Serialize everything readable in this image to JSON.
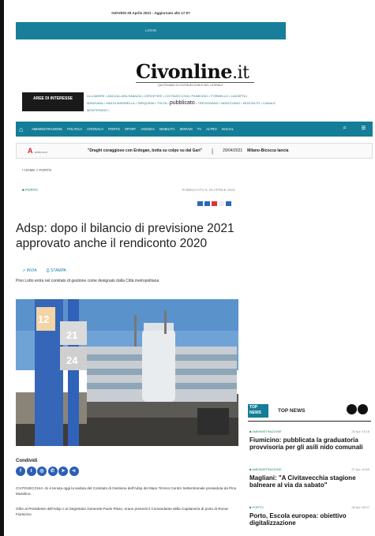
{
  "header": {
    "dateline": "GIOVEDI 29 Aprile 2021 - Aggiornato alle 17:07",
    "top_button": "LOGIN",
    "logo_main": "Civonline",
    "logo_tld": ".it",
    "logo_sub": "QUOTIDIANO DI CIVITAVECCHIA E DEL LITORALE",
    "aree_label": "AREE DI INTERESSE",
    "tags_line1": "ALLUMIERE • ANGUILLARA SABAZIA • CERVETERI • CIVITAVECCHIA • FIUMICINO • FORMELLO • LADISPOLI",
    "tags_line2": "MANZIANA • SANTA MARINELLA • TARQUINIA • TOLFA •",
    "tags_pubblicato": "pubblicato",
    "tags_line3": "• TREVIGNANO • BRACCIANO • MONTALTO • CANALE MONTERANO •"
  },
  "nav": {
    "home_icon": "home-icon",
    "items": [
      "AMMINISTRAZIONE",
      "POLITICA",
      "CRONACA",
      "PORTO",
      "SPORT",
      "AGENDA",
      "MOBILITÀ",
      "SERVIZI",
      "TV",
      "ALTRO",
      "SOCIAL"
    ],
    "search_icon": "search-icon",
    "menu_icon": "menu-icon"
  },
  "ticker": {
    "logo_text": "A",
    "logo_small": "adnkronos",
    "headline1": "\"Draghi coraggioso con Erdogan, botta su colpo su dal Gari\"",
    "separator": "|",
    "date": "29/04/2021",
    "headline2": "Milano-Bicocca lancia"
  },
  "article": {
    "breadcrumb": "• HOME  >  PORTO",
    "category": "■ PORTO",
    "published": "PUBBLICATO IL 29 APRILE 2021",
    "title": "Adsp: dopo il bilancio di previsione 2021 approvato anche il rendiconto 2020",
    "send_label": "INVIA",
    "print_label": "STAMPA",
    "lead": "Pino Lotto entra nel comitato di gestione come designato dalla Città metropolitana",
    "share_label": "Condividi",
    "paragraph1": "CIVITAVECCHIA -Si è tenuta oggi la seduta del Comitato di Gestione dell'Adsp del Mare Tirreno Centro Settentrionale presieduta da Pino Musolino.",
    "paragraph2": "Oltre al Presidente dell'Adsp e al Segretario Generale Paolo Risso, erano presenti il Comandante della Capitaneria di porto di Roma-Fiumicino"
  },
  "photo": {
    "sign_numbers": [
      "12",
      "21",
      "24"
    ]
  },
  "top_news": {
    "badge": "TOP NEWS",
    "label": "TOP NEWS",
    "items": [
      {
        "category": "■ AMMINISTRAZIONE",
        "date": "29 Apr 13:16",
        "title": "Fiumicino: pubblicata la graduatoria provvisoria per gli asili nido comunali"
      },
      {
        "category": "■ AMMINISTRAZIONE",
        "date": "27 Apr 10:00",
        "title": "Magliani: \"A Civitavecchia stagione balneare al via da sabato\""
      },
      {
        "category": "■ PORTO",
        "date": "28 Apr 15:07",
        "title": "Porto, Escola europea: obiettivo digitalizzazione"
      }
    ]
  },
  "colors": {
    "brand_teal": "#147d97",
    "category_green": "#2b8a5e",
    "link_blue": "#1f7ea8"
  }
}
